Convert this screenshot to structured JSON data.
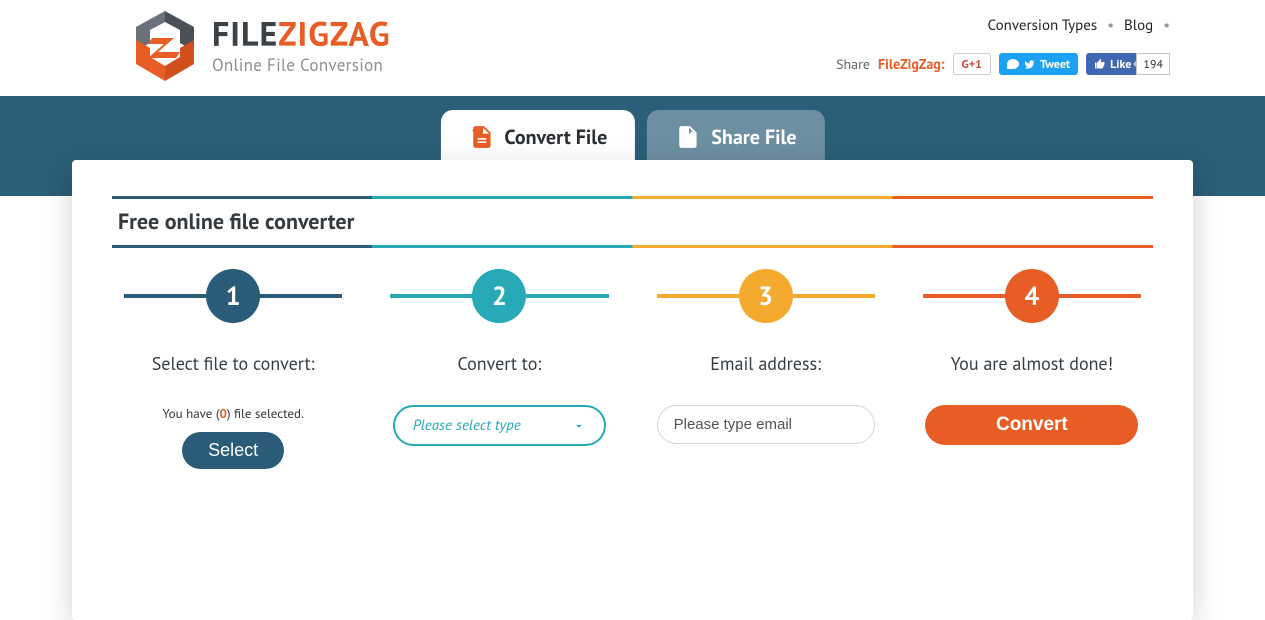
{
  "header": {
    "brand": {
      "file": "FILE",
      "zig": "ZIGZAG",
      "sub": "Online File Conversion"
    },
    "nav": {
      "conversion_types": "Conversion Types",
      "blog": "Blog"
    },
    "share": {
      "lead": "Share",
      "brand": "FileZigZag:",
      "gplus": "G+1",
      "tweet": "Tweet",
      "like": "Like",
      "like_count": "194"
    }
  },
  "tabs": {
    "convert": "Convert File",
    "share": "Share File"
  },
  "card": {
    "heading": "Free online file converter",
    "steps": {
      "s1": {
        "num": "1",
        "title": "Select file to convert:",
        "info_pre": "You have (",
        "info_zero": "0",
        "info_post": ") file selected.",
        "select_btn": "Select"
      },
      "s2": {
        "num": "2",
        "title": "Convert to:",
        "placeholder": "Please select type"
      },
      "s3": {
        "num": "3",
        "title": "Email address:",
        "placeholder": "Please type email"
      },
      "s4": {
        "num": "4",
        "title": "You are almost done!",
        "convert_btn": "Convert"
      }
    }
  }
}
